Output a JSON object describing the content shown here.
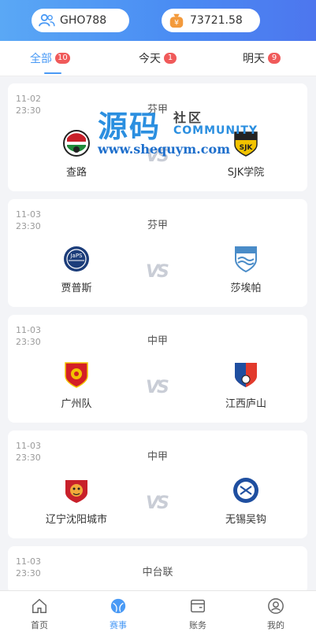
{
  "header": {
    "username": "GHO788",
    "balance": "73721.58"
  },
  "tabs": [
    {
      "label": "全部",
      "count": "10"
    },
    {
      "label": "今天",
      "count": "1"
    },
    {
      "label": "明天",
      "count": "9"
    }
  ],
  "watermark": {
    "big": "源码",
    "small": "社区",
    "community": "COMMUNITY",
    "url": "www.shequym.com"
  },
  "matches": [
    {
      "date": "11-02",
      "time": "23:30",
      "league": "芬甲",
      "home": "查路",
      "away": "SJK学院",
      "vs": "VS"
    },
    {
      "date": "11-03",
      "time": "23:30",
      "league": "芬甲",
      "home": "贾普斯",
      "away": "莎埃帕",
      "vs": "VS"
    },
    {
      "date": "11-03",
      "time": "23:30",
      "league": "中甲",
      "home": "广州队",
      "away": "江西庐山",
      "vs": "VS"
    },
    {
      "date": "11-03",
      "time": "23:30",
      "league": "中甲",
      "home": "辽宁沈阳城市",
      "away": "无锡吴钩",
      "vs": "VS"
    },
    {
      "date": "11-03",
      "time": "23:30",
      "league": "中台联"
    }
  ],
  "nav": [
    {
      "label": "首页"
    },
    {
      "label": "赛事"
    },
    {
      "label": "账务"
    },
    {
      "label": "我的"
    }
  ],
  "colors": {
    "accent": "#4a9af5",
    "badge": "#f05a5a"
  }
}
